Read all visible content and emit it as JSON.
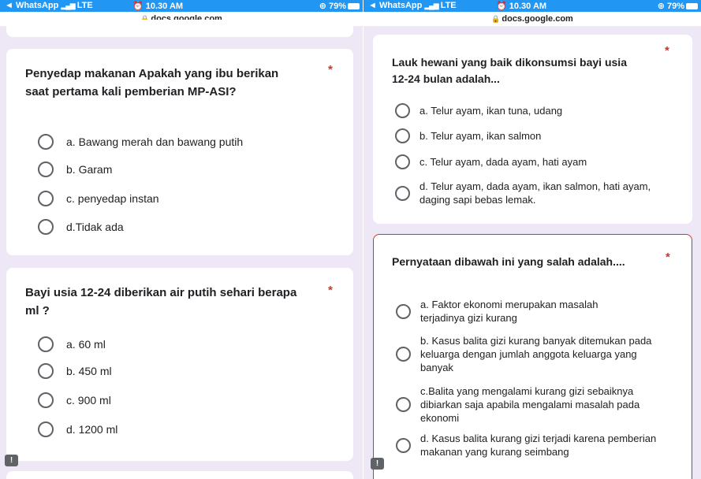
{
  "left": {
    "status": {
      "carrier": "◄ WhatsApp",
      "network": "LTE",
      "time": "10.30 AM",
      "battery": "79%"
    },
    "url": "docs.google.com",
    "question1": {
      "title": "Penyedap makanan Apakah yang ibu berikan saat pertama kali pemberian MP-ASI?",
      "required": "*",
      "options": [
        "a. Bawang merah dan bawang putih",
        "b. Garam",
        "c. penyedap instan",
        "d.Tidak ada"
      ]
    },
    "question2": {
      "title": "Bayi usia 12-24 diberikan air putih sehari berapa ml ?",
      "required": "*",
      "options": [
        "a. 60 ml",
        "b. 450 ml",
        "c. 900 ml",
        "d. 1200 ml"
      ]
    },
    "report": "!"
  },
  "right": {
    "status": {
      "carrier": "◄ WhatsApp",
      "network": "LTE",
      "time": "10.30 AM",
      "battery": "79%"
    },
    "url": "docs.google.com",
    "question1": {
      "title": "Lauk hewani yang baik dikonsumsi bayi usia 12-24 bulan adalah...",
      "required": "*",
      "options": [
        "a. Telur ayam, ikan tuna, udang",
        "b. Telur ayam, ikan salmon",
        "c. Telur ayam, dada ayam, hati ayam",
        "d. Telur ayam, dada ayam, ikan salmon, hati ayam, daging sapi bebas lemak."
      ]
    },
    "question2": {
      "title": "Pernyataan dibawah ini yang salah adalah....",
      "required": "*",
      "options": [
        "a. Faktor ekonomi merupakan masalah terjadinya gizi kurang",
        "b. Kasus balita gizi kurang banyak ditemukan pada keluarga dengan jumlah anggota keluarga yang banyak",
        "c.Balita yang mengalami kurang gizi sebaiknya dibiarkan saja apabila mengalami masalah pada ekonomi",
        "d. Kasus balita kurang gizi terjadi karena pemberian makanan yang kurang seimbang"
      ]
    },
    "report": "!"
  },
  "colors": {
    "statusbar": "#2196f3",
    "background": "#ede7f6",
    "required": "#d93025",
    "error_border": "#d93025"
  }
}
